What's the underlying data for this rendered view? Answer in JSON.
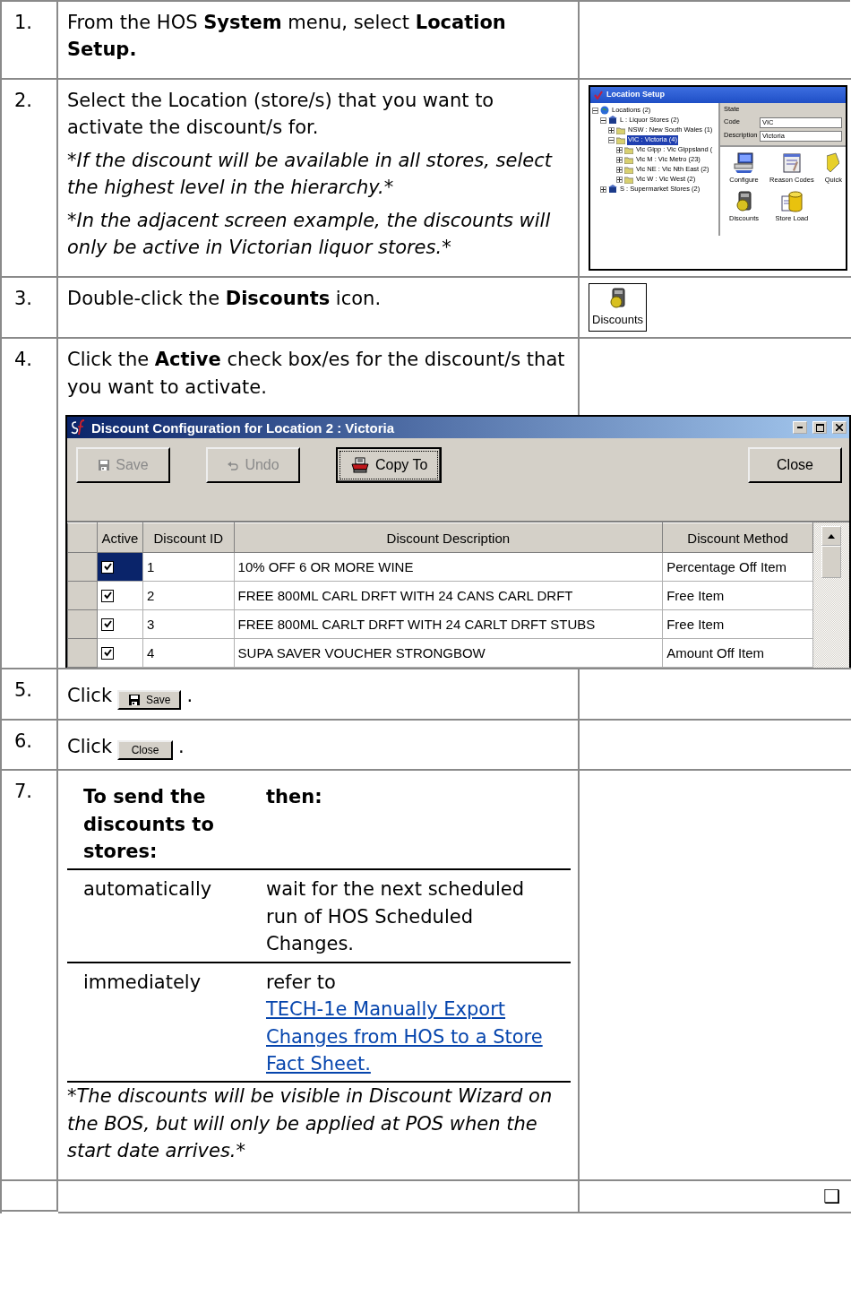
{
  "steps": [
    {
      "number": "1.",
      "paragraphs": [
        {
          "kind": "plain",
          "text": "From the HOS **System** menu, select **Location Setup.**"
        }
      ]
    },
    {
      "number": "2.",
      "paragraphs": [
        {
          "kind": "plain",
          "text": "Select the Location (store/s) that you want to activate the discount/s for."
        },
        {
          "kind": "note",
          "text": "*If the discount will be available in all stores, select the highest level in the hierarchy.*"
        },
        {
          "kind": "note",
          "text": "*In the adjacent screen example, the discounts will only be active in Victorian liquor stores.*"
        }
      ],
      "figure": {
        "kind": "location_setup",
        "title": "Location Setup",
        "tree": [
          {
            "label": "Locations (2)",
            "expanded": true,
            "selected": false,
            "children": [
              {
                "label": "L : Liquor Stores (2)",
                "expanded": true,
                "selected": false,
                "children": [
                  {
                    "label": "NSW : New South Wales (1)",
                    "expanded": false,
                    "selected": false
                  },
                  {
                    "label": "VIC : Victoria (4)",
                    "expanded": true,
                    "selected": true,
                    "children": [
                      {
                        "label": "Vic Gipp : Vic Gippsland (",
                        "expanded": false,
                        "selected": false
                      },
                      {
                        "label": "Vic M : Vic Metro (23)",
                        "expanded": false,
                        "selected": false
                      },
                      {
                        "label": "Vic NE : Vic Nth East (2)",
                        "expanded": false,
                        "selected": false
                      },
                      {
                        "label": "Vic W : Vic West (2)",
                        "expanded": false,
                        "selected": false
                      }
                    ]
                  }
                ]
              },
              {
                "label": "S : Supermarket Stores (2)",
                "expanded": false,
                "selected": false
              }
            ]
          }
        ],
        "group": "State",
        "fields": [
          {
            "label": "Code",
            "value": "VIC"
          },
          {
            "label": "Description",
            "value": "Victoria"
          }
        ],
        "tools": [
          {
            "kind": "configure",
            "label": "Configure"
          },
          {
            "kind": "reason_codes",
            "label": "Reason Codes"
          },
          {
            "kind": "quick",
            "label": "Quick"
          },
          {
            "kind": "discounts",
            "label": "Discounts"
          },
          {
            "kind": "store_load",
            "label": "Store Load"
          }
        ]
      }
    },
    {
      "number": "3.",
      "paragraphs": [
        {
          "kind": "plain",
          "text": "Double-click the **Discounts** icon."
        }
      ],
      "figure": {
        "kind": "icon_tile",
        "label": "Discounts"
      }
    },
    {
      "number": "4.",
      "paragraphs": [
        {
          "kind": "plain",
          "text": "Click the **Active** check box/es for the discount/s that you want to activate."
        }
      ],
      "figure": {
        "kind": "discount_window",
        "title": "Discount Configuration for Location 2 : Victoria",
        "buttons": [
          {
            "kind": "save",
            "label": "Save",
            "disabled": true,
            "focused": false
          },
          {
            "kind": "undo",
            "label": "Undo",
            "disabled": true,
            "focused": false
          },
          {
            "kind": "copy",
            "label": "Copy To",
            "disabled": false,
            "focused": true
          },
          {
            "kind": "close",
            "label": "Close",
            "disabled": false,
            "focused": false
          }
        ],
        "columns": [
          "Active",
          "Discount ID",
          "Discount Description",
          "Discount Method"
        ],
        "rows": [
          {
            "active": true,
            "selected": true,
            "id": "1",
            "description": "10% OFF 6 OR MORE WINE",
            "method": "Percentage Off Item"
          },
          {
            "active": true,
            "selected": false,
            "id": "2",
            "description": "FREE 800ML CARL DRFT WITH 24 CANS CARL DRFT",
            "method": "Free Item"
          },
          {
            "active": true,
            "selected": false,
            "id": "3",
            "description": "FREE 800ML CARLT DRFT WITH 24 CARLT DRFT STUBS",
            "method": "Free Item"
          },
          {
            "active": true,
            "selected": false,
            "id": "4",
            "description": "SUPA SAVER VOUCHER STRONGBOW",
            "method": "Amount Off Item"
          }
        ]
      }
    },
    {
      "number": "5.",
      "paragraphs": [
        {
          "kind": "click",
          "before": "Click",
          "button": {
            "kind": "save",
            "label": "Save"
          },
          "after": "."
        }
      ]
    },
    {
      "number": "6.",
      "paragraphs": [
        {
          "kind": "click",
          "before": "Click",
          "button": {
            "kind": "close",
            "label": "Close"
          },
          "after": "."
        }
      ]
    },
    {
      "number": "7.",
      "paragraphs": [
        {
          "kind": "decision",
          "header": [
            "To send the discounts to stores:",
            "then:"
          ],
          "rows": [
            {
              "condition": "automatically",
              "action": "wait for the next scheduled run of HOS Scheduled Changes."
            },
            {
              "condition": "immediately",
              "action": "refer to",
              "link": "TECH-1e Manually Export Changes from HOS to a Store Fact Sheet."
            }
          ]
        },
        {
          "kind": "note",
          "text": "*The discounts will be visible in Discount Wizard on the BOS, but will only be applied at POS when the start date arrives.*"
        }
      ]
    }
  ],
  "footer": {
    "mark": "❑"
  }
}
